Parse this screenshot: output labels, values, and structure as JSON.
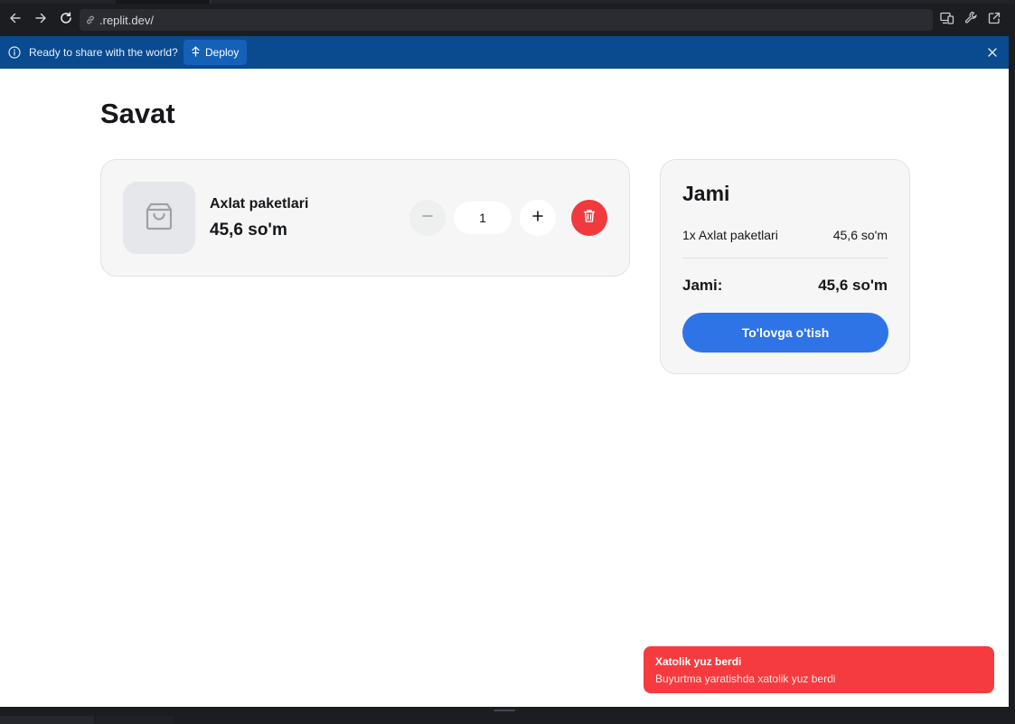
{
  "browser": {
    "url": ".replit.dev/"
  },
  "banner": {
    "message": "Ready to share with the world?",
    "deploy_label": "Deploy"
  },
  "page": {
    "title": "Savat"
  },
  "cart": {
    "items": [
      {
        "name": "Axlat paketlari",
        "price": "45,6 so'm",
        "quantity": "1"
      }
    ]
  },
  "summary": {
    "title": "Jami",
    "line_name": "1x Axlat paketlari",
    "line_price": "45,6 so'm",
    "total_label": "Jami:",
    "total_value": "45,6 so'm",
    "checkout_label": "To'lovga o'tish"
  },
  "toast": {
    "title": "Xatolik yuz berdi",
    "description": "Buyurtma yaratishda xatolik yuz berdi"
  },
  "colors": {
    "accent_blue": "#2f74e6",
    "danger_red": "#f03a3e",
    "banner_blue": "#0a4a8f",
    "card_bg": "#f5f6f5"
  },
  "icons": {
    "back": "arrow-left-icon",
    "forward": "arrow-right-icon",
    "reload": "reload-icon",
    "url": "link-icon",
    "devices": "devices-icon",
    "devtools": "wrench-icon",
    "external": "external-link-icon",
    "info": "info-icon",
    "deploy": "deploy-icon",
    "close": "close-icon",
    "product": "shopping-bag-icon",
    "minus": "minus-icon",
    "plus": "plus-icon",
    "delete": "trash-icon"
  }
}
